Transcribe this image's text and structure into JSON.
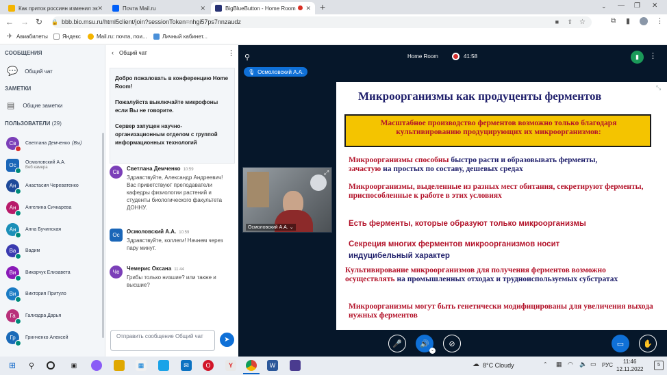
{
  "tabs": [
    {
      "title": "Как приток россиян изменил эк",
      "color": "#f4b400"
    },
    {
      "title": "Почта Mail.ru",
      "color": "#005ff9"
    },
    {
      "title": "BigBlueButton - Home Room",
      "color": "#283274"
    }
  ],
  "address": {
    "url": "bbb.bio.msu.ru/html5client/join?sessionToken=nhgi57ps7nnzaudz"
  },
  "bookmarks": [
    "Авиабилеты",
    "Яндекс",
    "Mail.ru: почта, пои...",
    "Личный кабинет..."
  ],
  "sidebar": {
    "messages_title": "СООБЩЕНИЯ",
    "public_chat": "Общий чат",
    "notes_title": "ЗАМЕТКИ",
    "shared_notes": "Общие заметки",
    "users_title": "ПОЛЬЗОВАТЕЛИ",
    "users_count": "(29)",
    "users": [
      {
        "initials": "Св",
        "name": "Светлана Демченко",
        "suffix": "(Вы)",
        "color": "#7b3fb8",
        "status": "red"
      },
      {
        "initials": "Ос",
        "name": "Осмоловский А.А.",
        "sub": "Веб камера",
        "color": "#1a66b8",
        "square": true
      },
      {
        "initials": "Ан",
        "name": "Анастасия Череватенко",
        "color": "#1e4a9a"
      },
      {
        "initials": "Ан",
        "name": "Ангелина Сичкарева",
        "color": "#b81a6a"
      },
      {
        "initials": "Ан",
        "name": "Анна Бучинская",
        "color": "#1a8fb8"
      },
      {
        "initials": "Ва",
        "name": "Вадим",
        "color": "#3a3ab0"
      },
      {
        "initials": "Ви",
        "name": "Викарчук Елизавета",
        "color": "#8a1ab8"
      },
      {
        "initials": "Ви",
        "name": "Виктория Притуло",
        "color": "#1a7bc4"
      },
      {
        "initials": "Га",
        "name": "Гализдра Дарья",
        "color": "#b8307a"
      },
      {
        "initials": "Гр",
        "name": "Гринченко Алексей",
        "color": "#1a6ab8"
      }
    ]
  },
  "chat": {
    "title": "Общий чат",
    "welcome": [
      "Добро пожаловать в конференцию Home Room!",
      "Пожалуйста выключайте микрофоны если Вы не говорите.",
      "Сервер запущен научно-организационным отделом с группой информационных технологий"
    ],
    "messages": [
      {
        "initials": "Св",
        "name": "Светлана Демченко",
        "time": "10:59",
        "text": "Здравствуйте, Александр Андреевич! Вас приветствуют преподаватели кафедры физиологии растений и студенты биологического факультета ДОННУ.",
        "color": "#7b3fb8"
      },
      {
        "initials": "Ос",
        "name": "Осмоловский А.А.",
        "time": "10:59",
        "text": "Здравствуйте, коллеги! Начнем через пару минут.",
        "color": "#1a66b8"
      },
      {
        "initials": "Че",
        "name": "Чемерис Оксана",
        "time": "11:44",
        "text": "Грибы только низшие? или также и высшие?",
        "color": "#7b3fb8"
      }
    ],
    "input_placeholder": "Отправить сообщение Общий чат"
  },
  "stage": {
    "room_name": "Home Room",
    "timer": "41:58",
    "presenter": "Осмоловский А.А.",
    "webcam_label": "Осмоловский А.А."
  },
  "slide": {
    "title": "Микроорганизмы как продуценты ферментов",
    "highlight": "Масштабное производство ферментов возможно только благодаря культивированию продуцирующих их микроорганизмов:",
    "b1a": "Микроорганизмы способны",
    "b1b": " быстро расти и образовывать ферменты,",
    "b1c": "зачастую",
    "b1d": " на простых по составу, дешевых средах",
    "b2": "Микроорганизмы, выделенные из разных мест обитания, секретируют ферменты, приспособленные к работе в этих условиях",
    "b3": "Есть ферменты, которые образуют только микроорганизмы",
    "b4a": "Секреция многих ферментов микроорганизмов носит",
    "b4b": "индуцибельный характер",
    "b5a": "Культивирование микроорганизмов для получения ферментов возможно осуществлять",
    "b5b": " на промышленных отходах и трудноиспользуемых субстратах",
    "b6": "Микроорганизмы могут быть генетически модифицированы для увеличения выхода нужных ферментов"
  },
  "taskbar": {
    "weather": "8°C  Cloudy",
    "lang": "РУС",
    "time": "11:46",
    "date": "12.11.2022",
    "badge": "5"
  }
}
